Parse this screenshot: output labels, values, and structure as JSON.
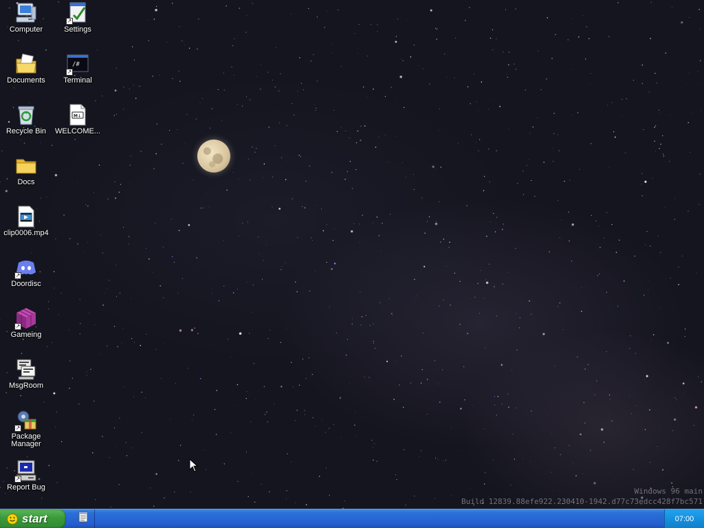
{
  "desktop": {
    "icons": [
      {
        "label": "Computer",
        "icon": "computer-icon"
      },
      {
        "label": "Settings",
        "icon": "settings-icon"
      },
      {
        "label": "Documents",
        "icon": "documents-icon"
      },
      {
        "label": "Terminal",
        "icon": "terminal-icon"
      },
      {
        "label": "Recycle Bin",
        "icon": "recycle-bin-icon"
      },
      {
        "label": "WELCOME...",
        "icon": "markdown-file-icon"
      },
      {
        "label": "Docs",
        "icon": "folder-icon"
      },
      {
        "label": "clip0006.mp4",
        "icon": "video-file-icon"
      },
      {
        "label": "Doordisc",
        "icon": "doordisc-icon"
      },
      {
        "label": "Gameing",
        "icon": "game-cube-icon"
      },
      {
        "label": "MsgRoom",
        "icon": "msgroom-icon"
      },
      {
        "label": "Package Manager",
        "icon": "package-manager-icon"
      },
      {
        "label": "Report Bug",
        "icon": "report-bug-icon"
      }
    ],
    "terminal_glyph": "/#",
    "markdown_glyph": "M↓"
  },
  "watermark": {
    "line1": "Windows 96 main",
    "line2": "Build 12839.88efe922.230410-1942.d77c73edcc428f7bc571"
  },
  "taskbar": {
    "start_label": "start",
    "quicklaunch_icon": "notepad-icon",
    "clock": "07:00"
  },
  "colors": {
    "taskbar": "#245fd0",
    "start_button": "#3c9a3c",
    "tray": "#1790de",
    "sky": "#15151f"
  }
}
